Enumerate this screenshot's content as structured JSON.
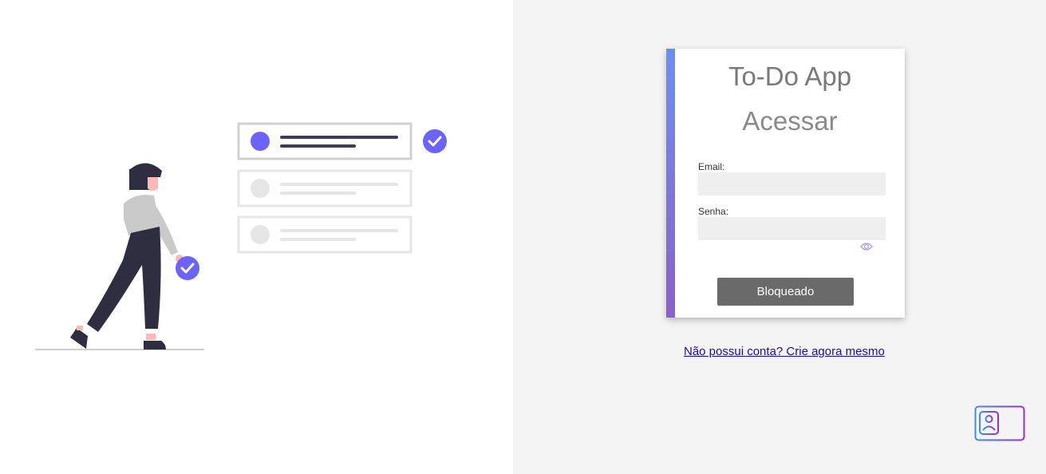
{
  "login": {
    "app_title": "To-Do App",
    "subtitle": "Acessar",
    "email_label": "Email:",
    "email_value": "",
    "password_label": "Senha:",
    "password_value": "",
    "submit_label": "Bloqueado",
    "signup_link": "Não possui conta? Crie agora mesmo"
  },
  "icons": {
    "password_toggle": "eye-icon",
    "floating_badge": "id-card-icon",
    "check": "check-circle-icon"
  },
  "colors": {
    "accent_top": "#6c8ff4",
    "accent_bottom": "#8a60cc",
    "illustration_purple": "#6c63ff",
    "button": "#6a6a6a",
    "link": "#1a0dab",
    "right_background": "#f4f4f4"
  }
}
